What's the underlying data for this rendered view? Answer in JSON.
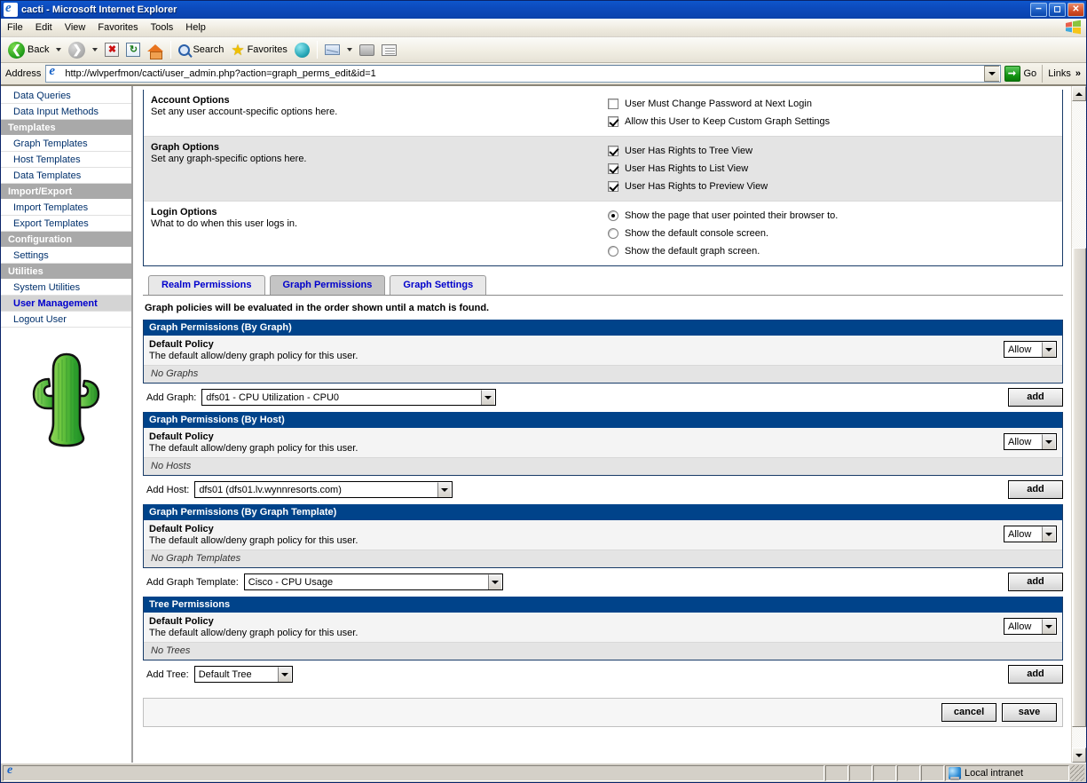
{
  "window": {
    "title": "cacti - Microsoft Internet Explorer",
    "icon": "ie-document-icon",
    "minimize_label": "_",
    "maximize_label": "□",
    "close_label": "✕"
  },
  "menubar": {
    "items": [
      {
        "label": "File"
      },
      {
        "label": "Edit"
      },
      {
        "label": "View"
      },
      {
        "label": "Favorites"
      },
      {
        "label": "Tools"
      },
      {
        "label": "Help"
      }
    ]
  },
  "toolbar": {
    "back_label": "Back",
    "search_label": "Search",
    "favorites_label": "Favorites"
  },
  "addressbar": {
    "label": "Address",
    "url": "http://wlvperfmon/cacti/user_admin.php?action=graph_perms_edit&id=1",
    "go_label": "Go",
    "links_label": "Links",
    "links_chevron": "»"
  },
  "sidebar": {
    "items": [
      {
        "label": "Data Queries",
        "type": "link"
      },
      {
        "label": "Data Input Methods",
        "type": "link"
      },
      {
        "label": "Templates",
        "type": "header"
      },
      {
        "label": "Graph Templates",
        "type": "link"
      },
      {
        "label": "Host Templates",
        "type": "link"
      },
      {
        "label": "Data Templates",
        "type": "link"
      },
      {
        "label": "Import/Export",
        "type": "header"
      },
      {
        "label": "Import Templates",
        "type": "link"
      },
      {
        "label": "Export Templates",
        "type": "link"
      },
      {
        "label": "Configuration",
        "type": "header"
      },
      {
        "label": "Settings",
        "type": "link"
      },
      {
        "label": "Utilities",
        "type": "header"
      },
      {
        "label": "System Utilities",
        "type": "link"
      },
      {
        "label": "User Management",
        "type": "current"
      },
      {
        "label": "Logout User",
        "type": "link"
      }
    ],
    "logo": "cactus-logo"
  },
  "options": {
    "rows": [
      {
        "title": "Account Options",
        "desc": "Set any user account-specific options here.",
        "shaded": false,
        "controls": [
          {
            "kind": "checkbox",
            "checked": false,
            "label": "User Must Change Password at Next Login"
          },
          {
            "kind": "checkbox",
            "checked": true,
            "label": "Allow this User to Keep Custom Graph Settings"
          }
        ]
      },
      {
        "title": "Graph Options",
        "desc": "Set any graph-specific options here.",
        "shaded": true,
        "controls": [
          {
            "kind": "checkbox",
            "checked": true,
            "label": "User Has Rights to Tree View"
          },
          {
            "kind": "checkbox",
            "checked": true,
            "label": "User Has Rights to List View"
          },
          {
            "kind": "checkbox",
            "checked": true,
            "label": "User Has Rights to Preview View"
          }
        ]
      },
      {
        "title": "Login Options",
        "desc": "What to do when this user logs in.",
        "shaded": false,
        "controls": [
          {
            "kind": "radio",
            "checked": true,
            "label": "Show the page that user pointed their browser to."
          },
          {
            "kind": "radio",
            "checked": false,
            "label": "Show the default console screen."
          },
          {
            "kind": "radio",
            "checked": false,
            "label": "Show the default graph screen."
          }
        ]
      }
    ]
  },
  "tabs": [
    {
      "label": "Realm Permissions",
      "active": false
    },
    {
      "label": "Graph Permissions",
      "active": true
    },
    {
      "label": "Graph Settings",
      "active": false
    }
  ],
  "policy_note": "Graph policies will be evaluated in the order shown until a match is found.",
  "sections": [
    {
      "header": "Graph Permissions (By Graph)",
      "policy_title": "Default Policy",
      "policy_desc": "The default allow/deny graph policy for this user.",
      "policy_value": "Allow",
      "empty_text": "No Graphs",
      "add_label": "Add Graph:",
      "add_value": "dfs01 - CPU Utilization - CPU0",
      "add_width": 332,
      "add_button": "add"
    },
    {
      "header": "Graph Permissions (By Host)",
      "policy_title": "Default Policy",
      "policy_desc": "The default allow/deny graph policy for this user.",
      "policy_value": "Allow",
      "empty_text": "No Hosts",
      "add_label": "Add Host:",
      "add_value": "dfs01 (dfs01.lv.wynnresorts.com)",
      "add_width": 291,
      "add_button": "add"
    },
    {
      "header": "Graph Permissions (By Graph Template)",
      "policy_title": "Default Policy",
      "policy_desc": "The default allow/deny graph policy for this user.",
      "policy_value": "Allow",
      "empty_text": "No Graph Templates",
      "add_label": "Add Graph Template:",
      "add_value": "Cisco - CPU Usage",
      "add_width": 292,
      "add_button": "add"
    },
    {
      "header": "Tree Permissions",
      "policy_title": "Default Policy",
      "policy_desc": "The default allow/deny graph policy for this user.",
      "policy_value": "Allow",
      "empty_text": "No Trees",
      "add_label": "Add Tree:",
      "add_value": "Default Tree",
      "add_width": 111,
      "add_button": "add"
    }
  ],
  "footer": {
    "cancel_label": "cancel",
    "save_label": "save"
  },
  "statusbar": {
    "message": "",
    "zone": "Local intranet"
  },
  "colors": {
    "section_header_bg": "#00438a",
    "sidebar_link": "#00306c",
    "tab_text": "#0000cc",
    "titlebar": "#0a4bbd"
  }
}
